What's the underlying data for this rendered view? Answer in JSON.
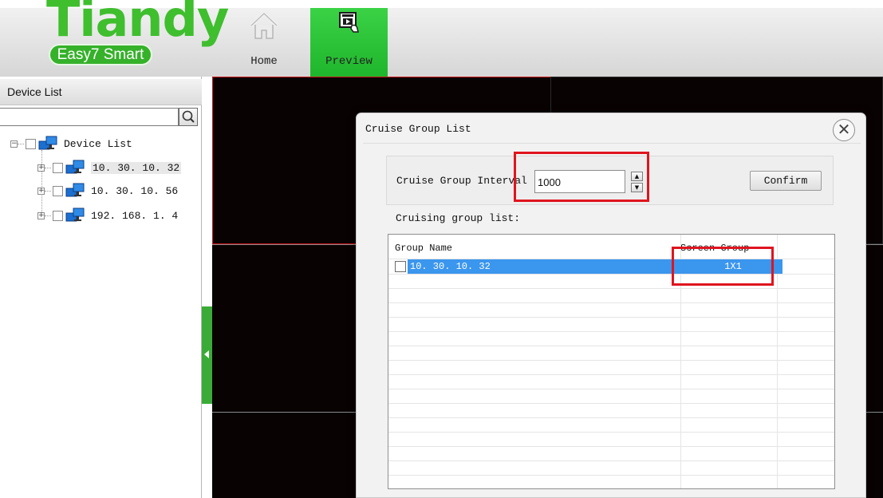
{
  "header": {
    "logo_text": "Tiandy",
    "logo_subtext": "Easy7 Smart",
    "nav": [
      {
        "label": "Home"
      },
      {
        "label": "Preview"
      }
    ]
  },
  "sidebar": {
    "title": "Device List",
    "search_placeholder": "",
    "tree_root": "Device List",
    "devices": [
      {
        "label": "10. 30. 10. 32"
      },
      {
        "label": "10. 30. 10. 56"
      },
      {
        "label": "192. 168. 1. 4"
      }
    ]
  },
  "dialog": {
    "title": "Cruise Group List",
    "interval_label": "Cruise Group Interval",
    "interval_value": "1000",
    "confirm_label": "Confirm",
    "list_caption": "Cruising group list:",
    "columns": [
      "Group Name",
      "Screen Group"
    ],
    "rows": [
      {
        "name": "10. 30. 10. 32",
        "screen": "1X1",
        "checked": false,
        "selected": true
      }
    ]
  },
  "colors": {
    "brand_green": "#3fbe2e",
    "active_nav": "#1fb52c",
    "selection_blue": "#3b96ee",
    "highlight_red": "#e0141e",
    "video_background": "#080203"
  }
}
